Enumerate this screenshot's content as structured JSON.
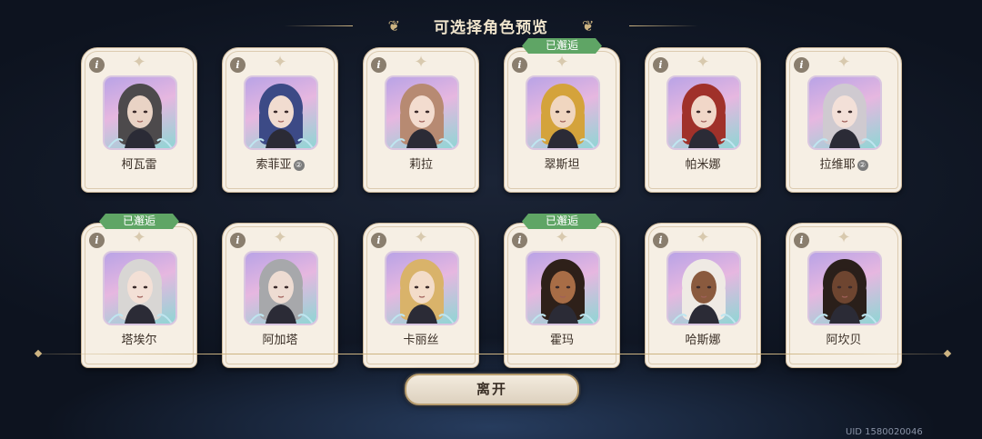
{
  "header": {
    "title": "可选择角色预览"
  },
  "characters": [
    {
      "name": "柯瓦雷",
      "badge": "",
      "met": "",
      "hair": "#4d4a4c",
      "skin": "#e9d3c5"
    },
    {
      "name": "索菲亚",
      "badge": "②",
      "met": "",
      "hair": "#3c4a86",
      "skin": "#f1dcd0"
    },
    {
      "name": "莉拉",
      "badge": "",
      "met": "",
      "hair": "#b78a72",
      "skin": "#f3dccf"
    },
    {
      "name": "翠斯坦",
      "badge": "",
      "met": "已邂逅",
      "hair": "#d4a33b",
      "skin": "#f0d6c0"
    },
    {
      "name": "帕米娜",
      "badge": "",
      "met": "",
      "hair": "#a0312a",
      "skin": "#f1d7c8"
    },
    {
      "name": "拉维耶",
      "badge": "②",
      "met": "",
      "hair": "#cfcad0",
      "skin": "#f3e0d8"
    },
    {
      "name": "塔埃尔",
      "badge": "",
      "met": "已邂逅",
      "hair": "#d8d6d4",
      "skin": "#f3e0d6"
    },
    {
      "name": "阿加塔",
      "badge": "",
      "met": "",
      "hair": "#a7a8ab",
      "skin": "#eedcd2"
    },
    {
      "name": "卡丽丝",
      "badge": "",
      "met": "",
      "hair": "#d9b36a",
      "skin": "#f3dcc9"
    },
    {
      "name": "霍玛",
      "badge": "",
      "met": "已邂逅",
      "hair": "#2e2019",
      "skin": "#a86d46"
    },
    {
      "name": "哈斯娜",
      "badge": "",
      "met": "",
      "hair": "#efeae4",
      "skin": "#8a5a3e"
    },
    {
      "name": "阿坎贝",
      "badge": "",
      "met": "",
      "hair": "#2a1f1a",
      "skin": "#6e4530"
    }
  ],
  "footer": {
    "leave_label": "离开",
    "uid": "UID 1580020046"
  },
  "colors": {
    "met_badge": "#5fa565",
    "accent_gold": "#cdb482"
  }
}
